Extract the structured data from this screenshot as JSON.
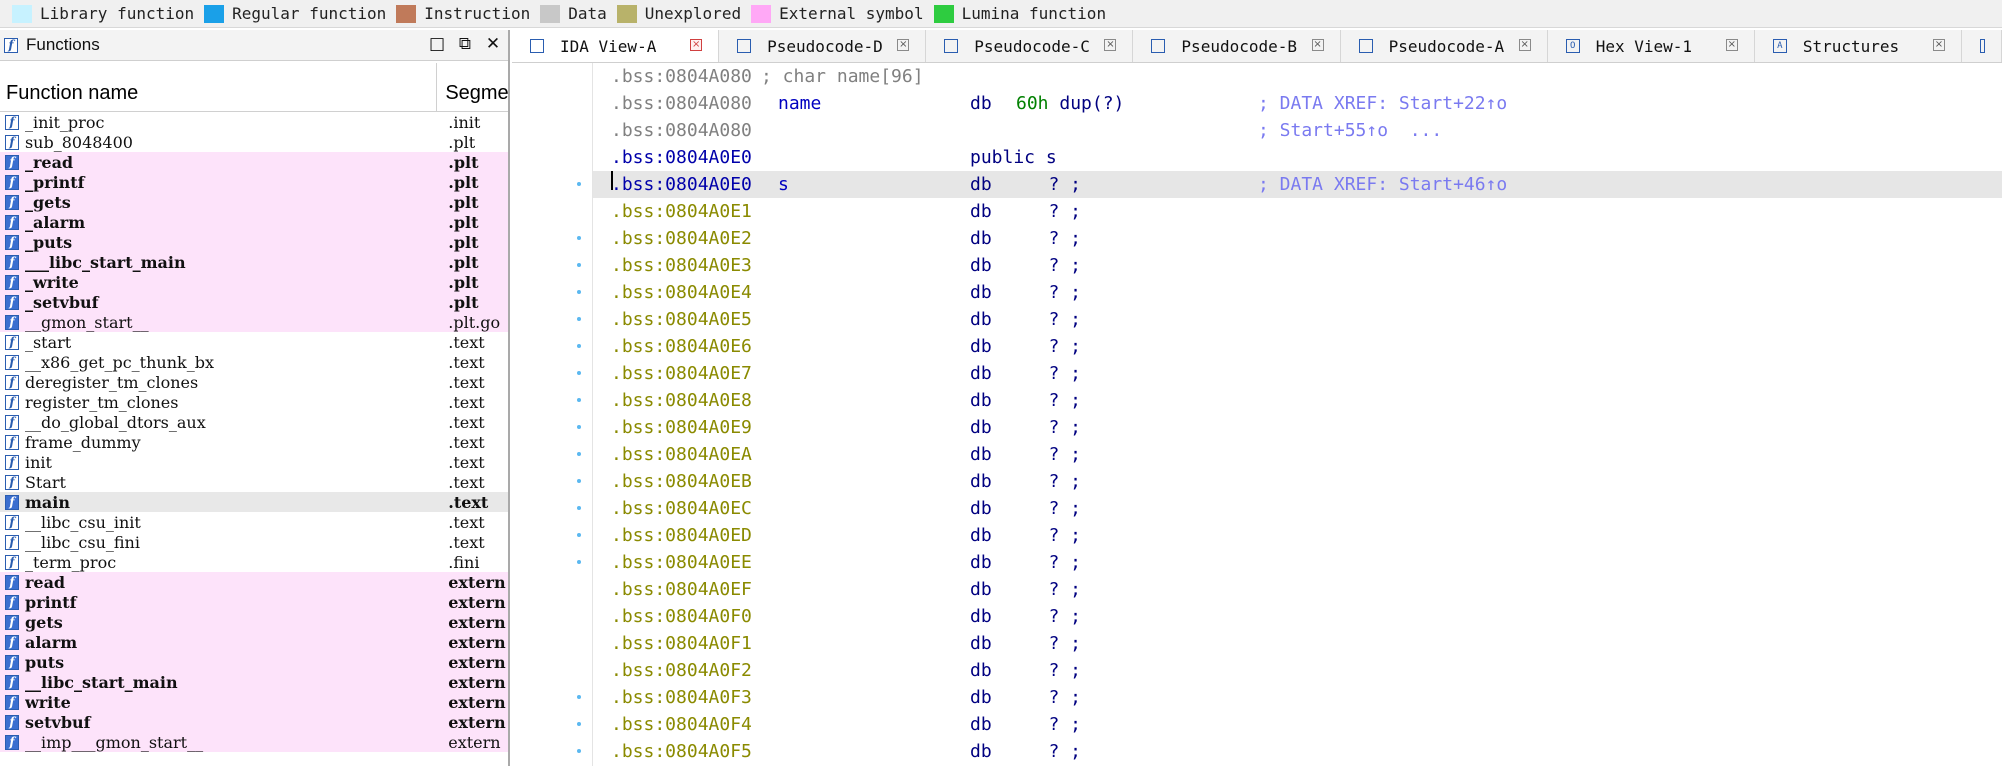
{
  "legend": [
    {
      "label": "Library function",
      "color": "#c7f2ff"
    },
    {
      "label": "Regular function",
      "color": "#1aa0e8"
    },
    {
      "label": "Instruction",
      "color": "#c07a5a"
    },
    {
      "label": "Data",
      "color": "#c8c8c8"
    },
    {
      "label": "Unexplored",
      "color": "#b8b26a"
    },
    {
      "label": "External symbol",
      "color": "#ffa8f6"
    },
    {
      "label": "Lumina function",
      "color": "#2ecc40"
    }
  ],
  "functions_panel": {
    "title": "Functions",
    "col_name": "Function name",
    "col_segment": "Segme",
    "rows": [
      {
        "name": "_init_proc",
        "seg": ".init",
        "style": ""
      },
      {
        "name": "sub_8048400",
        "seg": ".plt",
        "style": ""
      },
      {
        "name": "_read",
        "seg": ".plt",
        "style": "pink bold"
      },
      {
        "name": "_printf",
        "seg": ".plt",
        "style": "pink bold"
      },
      {
        "name": "_gets",
        "seg": ".plt",
        "style": "pink bold"
      },
      {
        "name": "_alarm",
        "seg": ".plt",
        "style": "pink bold"
      },
      {
        "name": "_puts",
        "seg": ".plt",
        "style": "pink bold"
      },
      {
        "name": "___libc_start_main",
        "seg": ".plt",
        "style": "pink bold"
      },
      {
        "name": "_write",
        "seg": ".plt",
        "style": "pink bold"
      },
      {
        "name": "_setvbuf",
        "seg": ".plt",
        "style": "pink bold"
      },
      {
        "name": "__gmon_start__",
        "seg": ".plt.go",
        "style": "pink"
      },
      {
        "name": "_start",
        "seg": ".text",
        "style": ""
      },
      {
        "name": "__x86_get_pc_thunk_bx",
        "seg": ".text",
        "style": ""
      },
      {
        "name": "deregister_tm_clones",
        "seg": ".text",
        "style": ""
      },
      {
        "name": "register_tm_clones",
        "seg": ".text",
        "style": ""
      },
      {
        "name": "__do_global_dtors_aux",
        "seg": ".text",
        "style": ""
      },
      {
        "name": "frame_dummy",
        "seg": ".text",
        "style": ""
      },
      {
        "name": "init",
        "seg": ".text",
        "style": ""
      },
      {
        "name": "Start",
        "seg": ".text",
        "style": ""
      },
      {
        "name": "main",
        "seg": ".text",
        "style": "sel bold"
      },
      {
        "name": "__libc_csu_init",
        "seg": ".text",
        "style": ""
      },
      {
        "name": "__libc_csu_fini",
        "seg": ".text",
        "style": ""
      },
      {
        "name": "_term_proc",
        "seg": ".fini",
        "style": ""
      },
      {
        "name": "read",
        "seg": "extern",
        "style": "pink bold"
      },
      {
        "name": "printf",
        "seg": "extern",
        "style": "pink bold"
      },
      {
        "name": "gets",
        "seg": "extern",
        "style": "pink bold"
      },
      {
        "name": "alarm",
        "seg": "extern",
        "style": "pink bold"
      },
      {
        "name": "puts",
        "seg": "extern",
        "style": "pink bold"
      },
      {
        "name": "__libc_start_main",
        "seg": "extern",
        "style": "pink bold"
      },
      {
        "name": "write",
        "seg": "extern",
        "style": "pink bold"
      },
      {
        "name": "setvbuf",
        "seg": "extern",
        "style": "pink bold"
      },
      {
        "name": "__imp___gmon_start__",
        "seg": "extern",
        "style": "pink"
      }
    ]
  },
  "tabs": [
    {
      "label": "IDA View-A",
      "active": true,
      "close_red": true
    },
    {
      "label": "Pseudocode-D",
      "active": false,
      "close_red": false
    },
    {
      "label": "Pseudocode-C",
      "active": false,
      "close_red": false
    },
    {
      "label": "Pseudocode-B",
      "active": false,
      "close_red": false
    },
    {
      "label": "Pseudocode-A",
      "active": false,
      "close_red": false
    },
    {
      "label": "Hex View-1",
      "active": false,
      "close_red": false
    },
    {
      "label": "Structures",
      "active": false,
      "close_red": false
    }
  ],
  "listing": [
    {
      "addr": ".bss:0804A080",
      "kind": "comment_line",
      "text": "; char name[96]"
    },
    {
      "addr": ".bss:0804A080",
      "kind": "named",
      "label": "name",
      "op": "db",
      "arg": "60h dup(?)",
      "comment": "; DATA XREF: Start+22↑o"
    },
    {
      "addr": ".bss:0804A080",
      "kind": "xref_cont",
      "comment": "; Start+55↑o  ..."
    },
    {
      "addr": ".bss:0804A0E0",
      "kind": "public",
      "op": "public s"
    },
    {
      "addr": ".bss:0804A0E0",
      "kind": "named",
      "label": "s",
      "op": "db",
      "arg": "   ? ;",
      "comment": "; DATA XREF: Start+46↑o",
      "highlight": true
    },
    {
      "addr": ".bss:0804A0E1",
      "kind": "db"
    },
    {
      "addr": ".bss:0804A0E2",
      "kind": "db"
    },
    {
      "addr": ".bss:0804A0E3",
      "kind": "db"
    },
    {
      "addr": ".bss:0804A0E4",
      "kind": "db"
    },
    {
      "addr": ".bss:0804A0E5",
      "kind": "db"
    },
    {
      "addr": ".bss:0804A0E6",
      "kind": "db"
    },
    {
      "addr": ".bss:0804A0E7",
      "kind": "db"
    },
    {
      "addr": ".bss:0804A0E8",
      "kind": "db"
    },
    {
      "addr": ".bss:0804A0E9",
      "kind": "db"
    },
    {
      "addr": ".bss:0804A0EA",
      "kind": "db"
    },
    {
      "addr": ".bss:0804A0EB",
      "kind": "db"
    },
    {
      "addr": ".bss:0804A0EC",
      "kind": "db"
    },
    {
      "addr": ".bss:0804A0ED",
      "kind": "db"
    },
    {
      "addr": ".bss:0804A0EE",
      "kind": "db"
    },
    {
      "addr": ".bss:0804A0EF",
      "kind": "db"
    },
    {
      "addr": ".bss:0804A0F0",
      "kind": "db"
    },
    {
      "addr": ".bss:0804A0F1",
      "kind": "db"
    },
    {
      "addr": ".bss:0804A0F2",
      "kind": "db"
    },
    {
      "addr": ".bss:0804A0F3",
      "kind": "db"
    },
    {
      "addr": ".bss:0804A0F4",
      "kind": "db"
    },
    {
      "addr": ".bss:0804A0F5",
      "kind": "db"
    }
  ],
  "db_text": {
    "op": "db",
    "arg": "   ? ;"
  }
}
